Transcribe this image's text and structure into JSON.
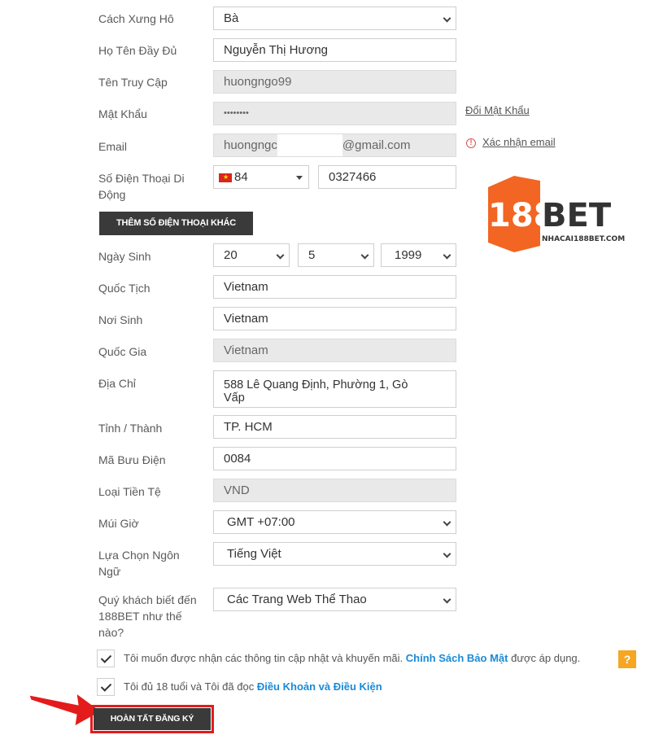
{
  "form": {
    "salutation": {
      "label": "Cách Xưng Hô",
      "value": "Bà"
    },
    "full_name": {
      "label": "Họ Tên Đầy Đủ",
      "value": "Nguyễn Thị Hương"
    },
    "username": {
      "label": "Tên Truy Cập",
      "value": "huongngo99"
    },
    "password": {
      "label": "Mật Khẩu",
      "value": "••••••••",
      "link": "Đổi Mật Khẩu"
    },
    "email": {
      "label": "Email",
      "value_start": "huongngc",
      "value_end": "@gmail.com",
      "link": "Xác nhận email"
    },
    "phone": {
      "label": "Số Điện Thoại Di Động",
      "country_code": "84",
      "number": "0327466"
    },
    "add_phone_button": "THÊM SỐ ĐIỆN THOẠI KHÁC",
    "birthdate": {
      "label": "Ngày Sinh",
      "day": "20",
      "month": "5",
      "year": "1999"
    },
    "nationality": {
      "label": "Quốc Tịch",
      "value": "Vietnam"
    },
    "birthplace": {
      "label": "Nơi Sinh",
      "value": "Vietnam"
    },
    "country": {
      "label": "Quốc Gia",
      "value": "Vietnam"
    },
    "address": {
      "label": "Địa Chỉ",
      "line1": "588 Lê Quang Định, Phường 1, Gò",
      "line2": "Vấp"
    },
    "province": {
      "label": "Tỉnh / Thành",
      "value": "TP. HCM"
    },
    "postal": {
      "label": "Mã Bưu Điện",
      "value": "0084"
    },
    "currency": {
      "label": "Loại Tiền Tệ",
      "value": "VND"
    },
    "timezone": {
      "label": "Múi Giờ",
      "value": "GMT +07:00"
    },
    "language": {
      "label_1": "Lựa Chọn Ngôn",
      "label_2": "Ngữ",
      "value": "Tiếng Việt"
    },
    "referral": {
      "label_1": "Quý khách biết đến",
      "label_2": "188BET như thế",
      "label_3": "nào?",
      "value": "Các Trang Web Thể Thao"
    },
    "consent_promo": {
      "text": "Tôi muốn được nhận các thông tin cập nhật và khuyến mãi.",
      "link": "Chính Sách Bảo Mật",
      "suffix": "được áp dụng.",
      "checked": true,
      "help": "?"
    },
    "consent_age": {
      "text": "Tôi đủ 18 tuổi và Tôi đã đọc",
      "link": "Điều Khoản và Điều Kiện",
      "checked": true
    },
    "submit_button": "HOÀN TẤT ĐĂNG KÝ"
  },
  "logo": {
    "brand_number": "188",
    "brand_text": "BET",
    "site": "NHACAI188BET.COM",
    "color": "#f26522"
  },
  "colors": {
    "link_blue": "#1a8ad6",
    "arrow_red": "#e31b1b",
    "help_orange": "#f5a623"
  }
}
